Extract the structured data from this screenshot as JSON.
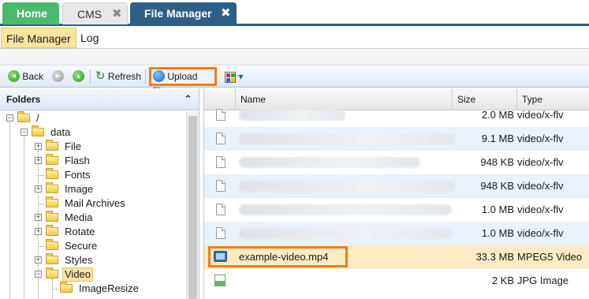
{
  "tabs": {
    "home": "Home",
    "cms": "CMS",
    "file_manager": "File Manager",
    "close_glyph": "✖"
  },
  "subtabs": {
    "file_manager": "File Manager",
    "log": "Log"
  },
  "toolbar": {
    "back": "Back",
    "refresh": "Refresh",
    "upload": "Upload files",
    "dropdown_glyph": "▾",
    "back_icon": "arrow-left-circle-icon",
    "forward_icon": "arrow-right-circle-icon",
    "up_icon": "arrow-up-circle-icon",
    "refresh_icon": "refresh-icon",
    "upload_icon": "globe-upload-icon",
    "view_icon": "view-grid-icon"
  },
  "folders": {
    "title": "Folders",
    "collapse_glyph": "⌃",
    "tree": [
      {
        "label": "/"
      },
      {
        "label": "data"
      },
      {
        "label": "File"
      },
      {
        "label": "Flash"
      },
      {
        "label": "Fonts"
      },
      {
        "label": "Image"
      },
      {
        "label": "Mail Archives"
      },
      {
        "label": "Media"
      },
      {
        "label": "Rotate"
      },
      {
        "label": "Secure"
      },
      {
        "label": "Styles"
      },
      {
        "label": "Video"
      },
      {
        "label": "ImageResize"
      }
    ]
  },
  "grid": {
    "columns": {
      "name": "Name",
      "size": "Size",
      "type": "Type"
    },
    "rows": [
      {
        "name": "",
        "size": "2.0 MB",
        "type": "video/x-flv",
        "icon": "file-icon"
      },
      {
        "name": "",
        "size": "9.1 MB",
        "type": "video/x-flv",
        "icon": "file-icon"
      },
      {
        "name": "",
        "size": "948 KB",
        "type": "video/x-flv",
        "icon": "file-icon"
      },
      {
        "name": "",
        "size": "948 KB",
        "type": "video/x-flv",
        "icon": "file-icon"
      },
      {
        "name": "",
        "size": "1.0 MB",
        "type": "video/x-flv",
        "icon": "file-icon"
      },
      {
        "name": "",
        "size": "1.0 MB",
        "type": "video/x-flv",
        "icon": "file-icon"
      },
      {
        "name": "example-video.mp4",
        "size": "33.3 MB",
        "type": "MPEG5 Video",
        "icon": "video-file-icon"
      },
      {
        "name": "",
        "size": "2 KB",
        "type": "JPG Image",
        "icon": "jpg-file-icon"
      }
    ]
  },
  "colors": {
    "accent": "#2e5f86",
    "home_tab": "#4aba6e",
    "highlight_box": "#f07d1c",
    "selected_row": "#fbecc4"
  }
}
